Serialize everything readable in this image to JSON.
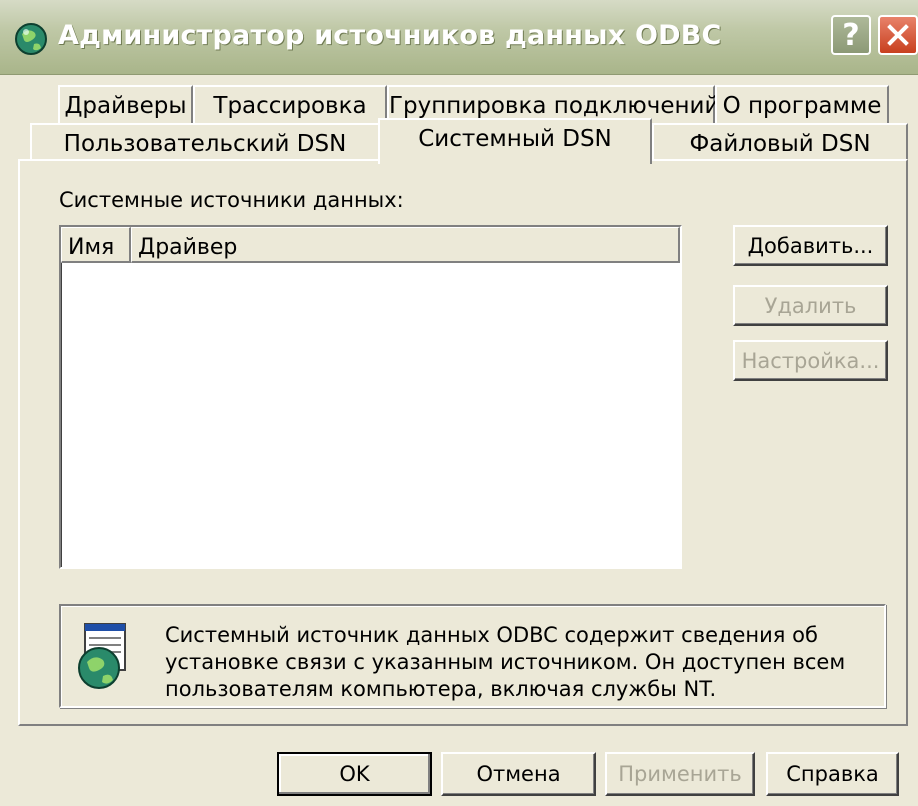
{
  "window": {
    "title": "Администратор источников данных ODBC",
    "help_glyph": "?"
  },
  "tabs_row1": [
    {
      "label": "Драйверы"
    },
    {
      "label": "Трассировка"
    },
    {
      "label": "Группировка подключений"
    },
    {
      "label": "О программе"
    }
  ],
  "tabs_row2": [
    {
      "label": "Пользовательский DSN"
    },
    {
      "label": "Системный DSN",
      "active": true
    },
    {
      "label": "Файловый DSN"
    }
  ],
  "panel": {
    "list_label": "Системные источники данных:",
    "columns": [
      "Имя",
      "Драйвер"
    ],
    "rows": []
  },
  "side_buttons": {
    "add": "Добавить...",
    "remove": "Удалить",
    "configure": "Настройка..."
  },
  "info": {
    "lines": [
      "Системный источник данных ODBC содержит сведения об",
      "установке связи с указанным источником. Он доступен всем",
      "пользователям компьютера, включая службы NT."
    ]
  },
  "dialog_buttons": {
    "ok": "OK",
    "cancel": "Отмена",
    "apply": "Применить",
    "help": "Справка"
  },
  "colors": {
    "face": "#ece9d8",
    "disabled_text": "#a8a595",
    "close": "#c8401f"
  },
  "icons": [
    "odbc-globe-icon",
    "help-icon",
    "close-icon",
    "odbc-info-icon"
  ]
}
